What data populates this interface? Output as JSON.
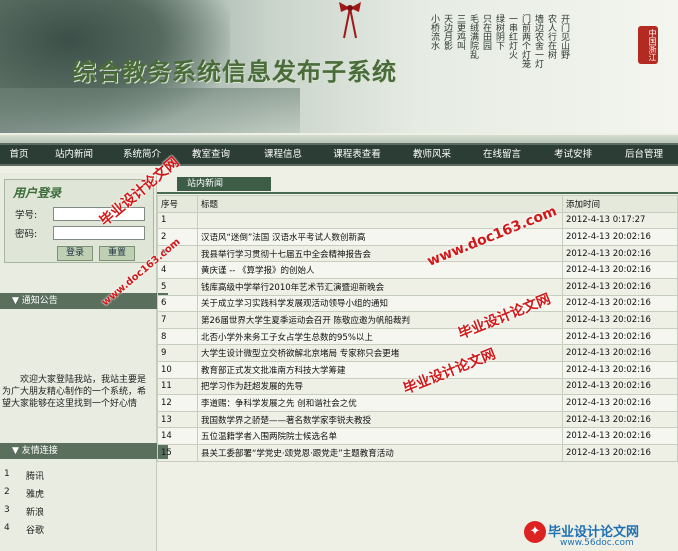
{
  "banner": {
    "logo": "综合教务系统信息发布子系统",
    "poem_lines": [
      "开门见山野",
      "农人行在树",
      "墙边农舍一灯",
      "门前两个灯笼",
      "一串红灯火",
      "绿树阴下",
      "只在田园",
      "毛绒满院乱",
      "三更鸡叫",
      "天边月影",
      "小桥流水"
    ],
    "seal": "中国浙江"
  },
  "nav": [
    "首页",
    "站内新闻",
    "系统简介",
    "教室查询",
    "课程信息",
    "课程表查看",
    "教师风采",
    "在线留言",
    "考试安排",
    "后台管理"
  ],
  "login": {
    "title": "用户登录",
    "id_label": "学号:",
    "pwd_label": "密码:",
    "login_btn": "登录",
    "reset_btn": "重置"
  },
  "notice": {
    "title": "通知公告",
    "text": "欢迎大家登陆我站，我站主要是为广大朋友精心制作的一个系统，希望大家能够在这里找到一个好心情"
  },
  "links": {
    "title": "友情连接",
    "items": [
      {
        "n": "1",
        "name": "腾讯"
      },
      {
        "n": "2",
        "name": "雅虎"
      },
      {
        "n": "3",
        "name": "新浪"
      },
      {
        "n": "4",
        "name": "谷歌"
      }
    ]
  },
  "news": {
    "tab": "站内新闻",
    "headers": {
      "no": "序号",
      "title": "标题",
      "time": "添加时间"
    },
    "rows": [
      {
        "no": "1",
        "title": "",
        "time": "2012-4-13  0:17:27"
      },
      {
        "no": "2",
        "title": "汉语风“迷倒”法国 汉语水平考试人数创新高",
        "time": "2012-4-13  20:02:16"
      },
      {
        "no": "3",
        "title": "我县举行学习贯彻十七届五中全会精神报告会",
        "time": "2012-4-13  20:02:16"
      },
      {
        "no": "4",
        "title": "黄庆谨 -- 《算学报》的创始人",
        "time": "2012-4-13  20:02:16"
      },
      {
        "no": "5",
        "title": "钱库高级中学举行2010年艺术节汇演暨迎新晚会",
        "time": "2012-4-13  20:02:16"
      },
      {
        "no": "6",
        "title": "关于成立学习实践科学发展观活动领导小组的通知",
        "time": "2012-4-13  20:02:16"
      },
      {
        "no": "7",
        "title": "第26届世界大学生夏季运动会召开 陈敬应邀为帆船裁判",
        "time": "2012-4-13  20:02:16"
      },
      {
        "no": "8",
        "title": "北否小学外来务工子女占学生总数的95%以上",
        "time": "2012-4-13  20:02:16"
      },
      {
        "no": "9",
        "title": "大学生设计微型立交桥欲解北京堵局 专家称只会更堵",
        "time": "2012-4-13  20:02:16"
      },
      {
        "no": "10",
        "title": "教育部正式发文批准南方科技大学筹建",
        "time": "2012-4-13  20:02:16"
      },
      {
        "no": "11",
        "title": "把学习作为赶超发展的先导",
        "time": "2012-4-13  20:02:16"
      },
      {
        "no": "12",
        "title": "李道赐：争科学发展之先 创和谐社会之优",
        "time": "2012-4-13  20:02:16"
      },
      {
        "no": "13",
        "title": "我国数学界之骄楚——著名数学家李锐夫教授",
        "time": "2012-4-13  20:02:16"
      },
      {
        "no": "14",
        "title": "五位温籍学者入围两院院士候选名单",
        "time": "2012-4-13  20:02:16"
      },
      {
        "no": "15",
        "title": "县关工委部署“学党史·颂党恩·跟党走”主题教育活动",
        "time": "2012-4-13  20:02:16"
      }
    ]
  },
  "watermarks": {
    "cn": "毕业设计论文网",
    "url": "www.doc163.com",
    "bottom_title": "毕业设计论文网",
    "bottom_url": "www.56doc.com"
  }
}
